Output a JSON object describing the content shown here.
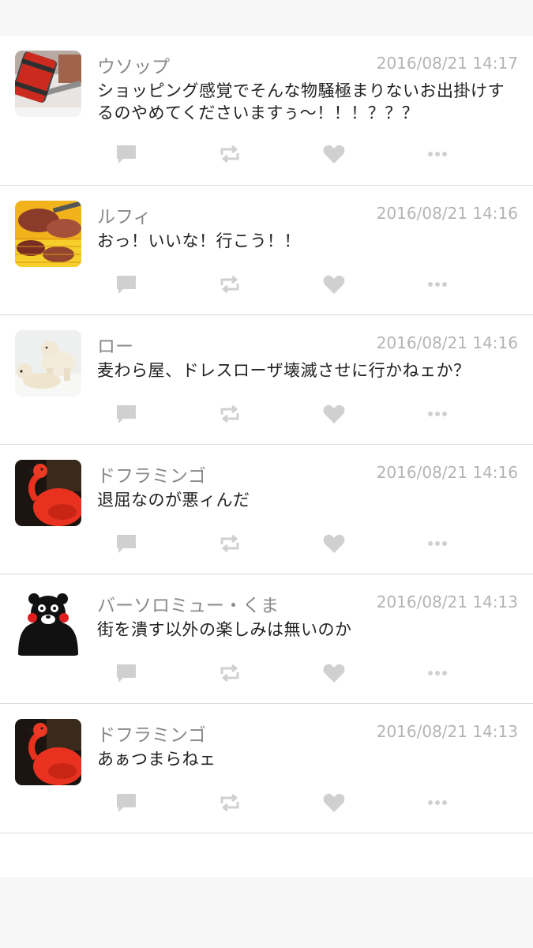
{
  "colors": {
    "background": "#f7f7f7",
    "card": "#ffffff",
    "divider": "#dcdcdc",
    "username": "#8a8a8a",
    "timestamp": "#b4b4b4",
    "message": "#222222",
    "action_icon": "#d0d0d0"
  },
  "posts": [
    {
      "avatar_icon": "hammer-avatar",
      "username": "ウソップ",
      "timestamp": "2016/08/21 14:17",
      "message": "ショッピング感覚でそんな物騒極まりないお出掛けするのやめてくださいますぅ〜！！！？？？"
    },
    {
      "avatar_icon": "grilled-meat-avatar",
      "username": "ルフィ",
      "timestamp": "2016/08/21 14:16",
      "message": "おっ！いいな！行こう！！"
    },
    {
      "avatar_icon": "polar-bear-avatar",
      "username": "ロー",
      "timestamp": "2016/08/21 14:16",
      "message": "麦わら屋、ドレスローザ壊滅させに行かねェか？"
    },
    {
      "avatar_icon": "flamingo-avatar",
      "username": "ドフラミンゴ",
      "timestamp": "2016/08/21 14:16",
      "message": "退屈なのが悪ィんだ"
    },
    {
      "avatar_icon": "kumamon-bear-avatar",
      "username": "バーソロミュー・くま",
      "timestamp": "2016/08/21 14:13",
      "message": "街を潰す以外の楽しみは無いのか"
    },
    {
      "avatar_icon": "flamingo-avatar",
      "username": "ドフラミンゴ",
      "timestamp": "2016/08/21 14:13",
      "message": "あぁつまらねェ"
    }
  ],
  "actions": {
    "reply_icon": "comment-icon",
    "repost_icon": "repost-icon",
    "like_icon": "heart-icon",
    "more_icon": "more-icon"
  }
}
